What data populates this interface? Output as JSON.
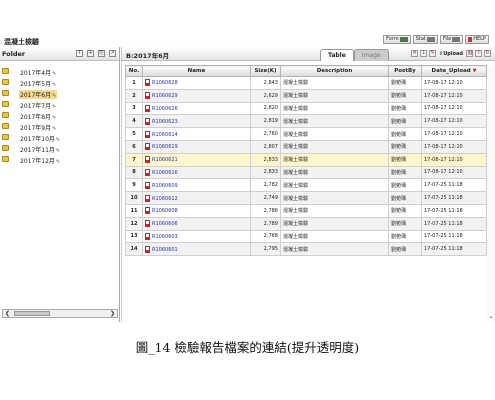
{
  "app": {
    "title": "混凝土檢驗"
  },
  "top_buttons": [
    {
      "label": "Form",
      "icon": "form-icon"
    },
    {
      "label": "Stat",
      "icon": "stat-icon"
    },
    {
      "label": "File",
      "icon": "file-icon"
    },
    {
      "label": "HELP",
      "icon": "help-icon"
    }
  ],
  "folder_panel": {
    "label": "Folder",
    "header_icons": [
      "T",
      "+",
      "⎘",
      "↗"
    ],
    "items": [
      {
        "label": "2017年4月"
      },
      {
        "label": "2017年5月"
      },
      {
        "label": "2017年6月",
        "selected": true
      },
      {
        "label": "2017年7月"
      },
      {
        "label": "2017年8月"
      },
      {
        "label": "2017年9月"
      },
      {
        "label": "2017年10月"
      },
      {
        "label": "2017年11月"
      },
      {
        "label": "2017年12月"
      }
    ]
  },
  "file_panel": {
    "path": "B:2017年6月",
    "tabs": [
      {
        "label": "Table",
        "active": true
      },
      {
        "label": "Image",
        "active": false
      }
    ],
    "upload_label": "Upload",
    "columns": [
      "No.",
      "Name",
      "Size(K)",
      "Description",
      "PostBy",
      "Date_Upload"
    ],
    "rows": [
      {
        "no": "1",
        "name": "R1060628",
        "size": "2,843",
        "desc": "混凝土檢驗",
        "post": "劉菀瑀",
        "date": "17-08-17 12:10"
      },
      {
        "no": "2",
        "name": "R1060629",
        "size": "2,629",
        "desc": "混凝土檢驗",
        "post": "劉菀瑀",
        "date": "17-08-17 12:10"
      },
      {
        "no": "3",
        "name": "R1060626",
        "size": "2,820",
        "desc": "混凝土檢驗",
        "post": "劉菀瑀",
        "date": "17-08-17 12:10"
      },
      {
        "no": "4",
        "name": "R1060623",
        "size": "2,819",
        "desc": "混凝土檢驗",
        "post": "劉菀瑀",
        "date": "17-08-17 12:10"
      },
      {
        "no": "5",
        "name": "R1060614",
        "size": "2,760",
        "desc": "混凝土檢驗",
        "post": "劉菀瑀",
        "date": "17-08-17 12:10"
      },
      {
        "no": "6",
        "name": "R1060619",
        "size": "2,807",
        "desc": "混凝土檢驗",
        "post": "劉菀瑀",
        "date": "17-08-17 12:10"
      },
      {
        "no": "7",
        "name": "R1060621",
        "size": "2,833",
        "desc": "混凝土檢驗",
        "post": "劉菀瑀",
        "date": "17-08-17 12:10",
        "highlight": true
      },
      {
        "no": "8",
        "name": "R1060616",
        "size": "2,833",
        "desc": "混凝土檢驗",
        "post": "劉菀瑀",
        "date": "17-08-17 12:10"
      },
      {
        "no": "9",
        "name": "R1060609",
        "size": "2,782",
        "desc": "混凝土檢驗",
        "post": "劉菀瑀",
        "date": "17-07-25 11:18"
      },
      {
        "no": "10",
        "name": "R1060612",
        "size": "2,749",
        "desc": "混凝土檢驗",
        "post": "劉菀瑀",
        "date": "17-07-25 11:18"
      },
      {
        "no": "11",
        "name": "R1060608",
        "size": "2,786",
        "desc": "混凝土檢驗",
        "post": "劉菀瑀",
        "date": "17-07-25 11:18"
      },
      {
        "no": "12",
        "name": "R1060606",
        "size": "2,789",
        "desc": "混凝土檢驗",
        "post": "劉菀瑀",
        "date": "17-07-25 11:18"
      },
      {
        "no": "13",
        "name": "R1060603",
        "size": "2,768",
        "desc": "混凝土檢驗",
        "post": "劉菀瑀",
        "date": "17-07-25 11:18"
      },
      {
        "no": "14",
        "name": "R1060601",
        "size": "2,795",
        "desc": "混凝土檢驗",
        "post": "劉菀瑀",
        "date": "17-07-25 11:18"
      }
    ]
  },
  "caption": "圖_14 檢驗報告檔案的連結(提升透明度)",
  "colors": {
    "folder": "#e8c34a",
    "selected_folder": "#f5d98a",
    "highlight_row": "#fff6cc",
    "link": "#2233bb"
  }
}
